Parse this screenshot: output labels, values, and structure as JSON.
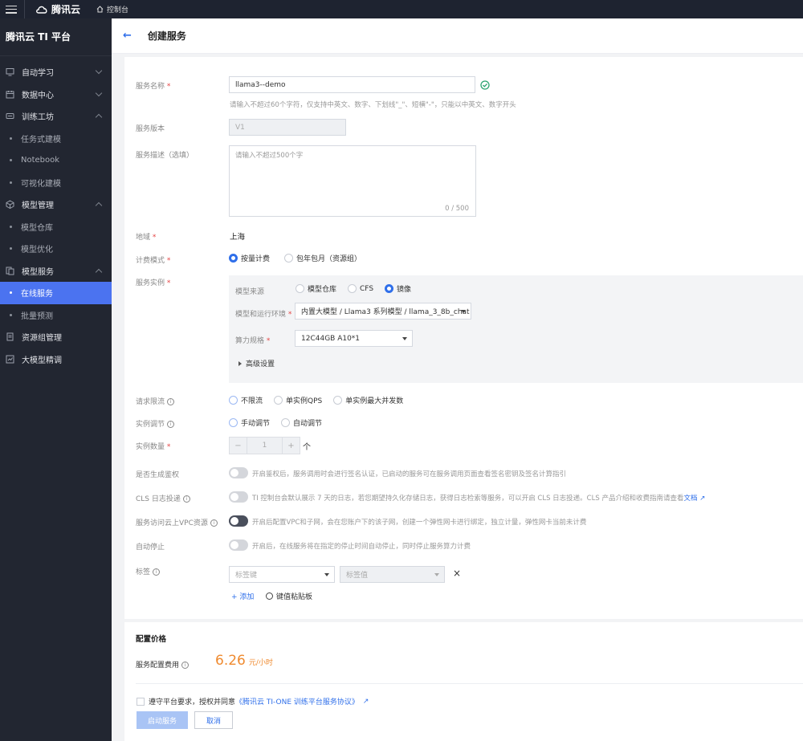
{
  "topbar": {
    "brand": "腾讯云",
    "console": "控制台"
  },
  "sidebar": {
    "platform": "腾讯云 TI 平台",
    "groups": [
      {
        "label": "自动学习"
      },
      {
        "label": "数据中心"
      },
      {
        "label": "训练工坊",
        "children": [
          "任务式建模",
          "Notebook",
          "可视化建模"
        ]
      },
      {
        "label": "模型管理",
        "children": [
          "模型仓库",
          "模型优化"
        ]
      },
      {
        "label": "模型服务",
        "children": [
          "在线服务",
          "批量预测"
        ]
      },
      {
        "label": "资源组管理"
      },
      {
        "label": "大模型精调"
      }
    ],
    "active": "在线服务"
  },
  "page": {
    "back": "←",
    "title": "创建服务"
  },
  "form": {
    "name": {
      "label": "服务名称",
      "value": "llama3--demo",
      "hint": "请输入不超过60个字符，仅支持中英文、数字、下划线\"_\"、短横\"-\"，只能以中英文、数字开头"
    },
    "version": {
      "label": "服务版本",
      "value": "V1"
    },
    "desc": {
      "label": "服务描述（选填）",
      "placeholder": "请输入不超过500个字",
      "counter": "0 / 500"
    },
    "region": {
      "label": "地域",
      "value": "上海"
    },
    "billing": {
      "label": "计费模式",
      "options": [
        "按量计费",
        "包年包月（资源组）"
      ]
    },
    "instance": {
      "label": "服务实例",
      "source_label": "模型来源",
      "source_options": [
        "模型仓库",
        "CFS",
        "镜像"
      ],
      "env_label": "模型和运行环境",
      "env_value": "内置大模型 / Llama3 系列模型 / llama_3_8b_chat",
      "spec_label": "算力规格",
      "spec_value": "12C44GB A10*1",
      "advanced": "高级设置"
    },
    "ratelimit": {
      "label": "请求限流",
      "options": [
        "不限流",
        "单实例QPS",
        "单实例最大并发数"
      ]
    },
    "scaling": {
      "label": "实例调节",
      "options": [
        "手动调节",
        "自动调节"
      ]
    },
    "count": {
      "label": "实例数量",
      "minus": "−",
      "value": "1",
      "plus": "+",
      "unit": "个"
    },
    "auth": {
      "label": "是否生成鉴权",
      "text": "开启鉴权后，服务调用时会进行签名认证，已启动的服务可在服务调用页面查看签名密钥及签名计算指引"
    },
    "cls": {
      "label": "CLS 日志投递",
      "text": "TI 控制台会默认展示 7 天的日志，若您期望持久化存储日志，获得日志检索等服务，可以开启 CLS 日志投递。CLS 产品介绍和收费指南请查看",
      "link": "文档"
    },
    "vpc": {
      "label": "服务访问云上VPC资源",
      "text": "开启后配置VPC和子网，会在您账户下的该子网，创建一个弹性网卡进行绑定，独立计量，弹性网卡当前未计费"
    },
    "autostop": {
      "label": "自动停止",
      "text": "开启后，在线服务将在指定的停止时间自动停止，同时停止服务算力计费"
    },
    "tags": {
      "label": "标签",
      "key_placeholder": "标签键",
      "value_placeholder": "标签值",
      "remove": "×",
      "add": "添加",
      "paste": "键值粘贴板"
    }
  },
  "pricing": {
    "title": "配置价格",
    "label": "服务配置费用",
    "price": "6.26",
    "unit": "元/小时"
  },
  "agreement": {
    "prefix": "遵守平台要求，授权并同意",
    "link": "《腾讯云 TI-ONE 训练平台服务协议》"
  },
  "actions": {
    "submit": "启动服务",
    "cancel": "取消"
  },
  "colors": {
    "accent": "#2f6fea",
    "price": "#ef8a2f",
    "sidebar": "#222631",
    "active_menu": "#4b73f0"
  }
}
